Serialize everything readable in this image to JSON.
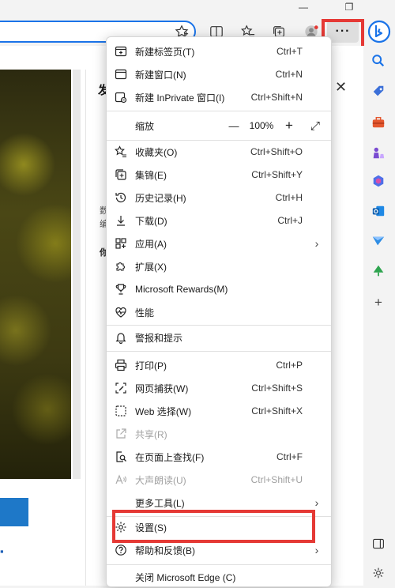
{
  "window": {
    "restore_glyph": "❐",
    "minimize_glyph": "—"
  },
  "toolbar": {
    "star_add": "☆",
    "split": "◫",
    "favorites": "☆",
    "collections": "⊕",
    "profile": "👤",
    "more": "···"
  },
  "panel": {
    "title": "发",
    "close": "✕",
    "frag1": "数",
    "frag2": "编",
    "frag3": "你"
  },
  "menu": {
    "new_tab": {
      "label": "新建标签页(T)",
      "shortcut": "Ctrl+T"
    },
    "new_window": {
      "label": "新建窗口(N)",
      "shortcut": "Ctrl+N"
    },
    "new_inprivate": {
      "label": "新建 InPrivate 窗口(I)",
      "shortcut": "Ctrl+Shift+N"
    },
    "zoom": {
      "label": "缩放",
      "minus": "—",
      "value": "100%",
      "plus": "+",
      "fullscreen": "⤢"
    },
    "favorites": {
      "label": "收藏夹(O)",
      "shortcut": "Ctrl+Shift+O"
    },
    "collections": {
      "label": "集锦(E)",
      "shortcut": "Ctrl+Shift+Y"
    },
    "history": {
      "label": "历史记录(H)",
      "shortcut": "Ctrl+H"
    },
    "downloads": {
      "label": "下载(D)",
      "shortcut": "Ctrl+J"
    },
    "apps": {
      "label": "应用(A)",
      "arrow": "›"
    },
    "extensions": {
      "label": "扩展(X)"
    },
    "rewards": {
      "label": "Microsoft Rewards(M)"
    },
    "performance": {
      "label": "性能"
    },
    "alerts": {
      "label": "警报和提示"
    },
    "print": {
      "label": "打印(P)",
      "shortcut": "Ctrl+P"
    },
    "web_capture": {
      "label": "网页捕获(W)",
      "shortcut": "Ctrl+Shift+S"
    },
    "web_select": {
      "label": "Web 选择(W)",
      "shortcut": "Ctrl+Shift+X"
    },
    "share": {
      "label": "共享(R)"
    },
    "find": {
      "label": "在页面上查找(F)",
      "shortcut": "Ctrl+F"
    },
    "read_aloud": {
      "label": "大声朗读(U)",
      "shortcut": "Ctrl+Shift+U"
    },
    "more_tools": {
      "label": "更多工具(L)",
      "arrow": "›"
    },
    "settings": {
      "label": "设置(S)"
    },
    "help": {
      "label": "帮助和反馈(B)",
      "arrow": "›"
    },
    "close_edge": {
      "label": "关闭 Microsoft Edge (C)"
    }
  },
  "colors": {
    "highlight_red": "#e53935",
    "accent_blue": "#1a73e8"
  }
}
